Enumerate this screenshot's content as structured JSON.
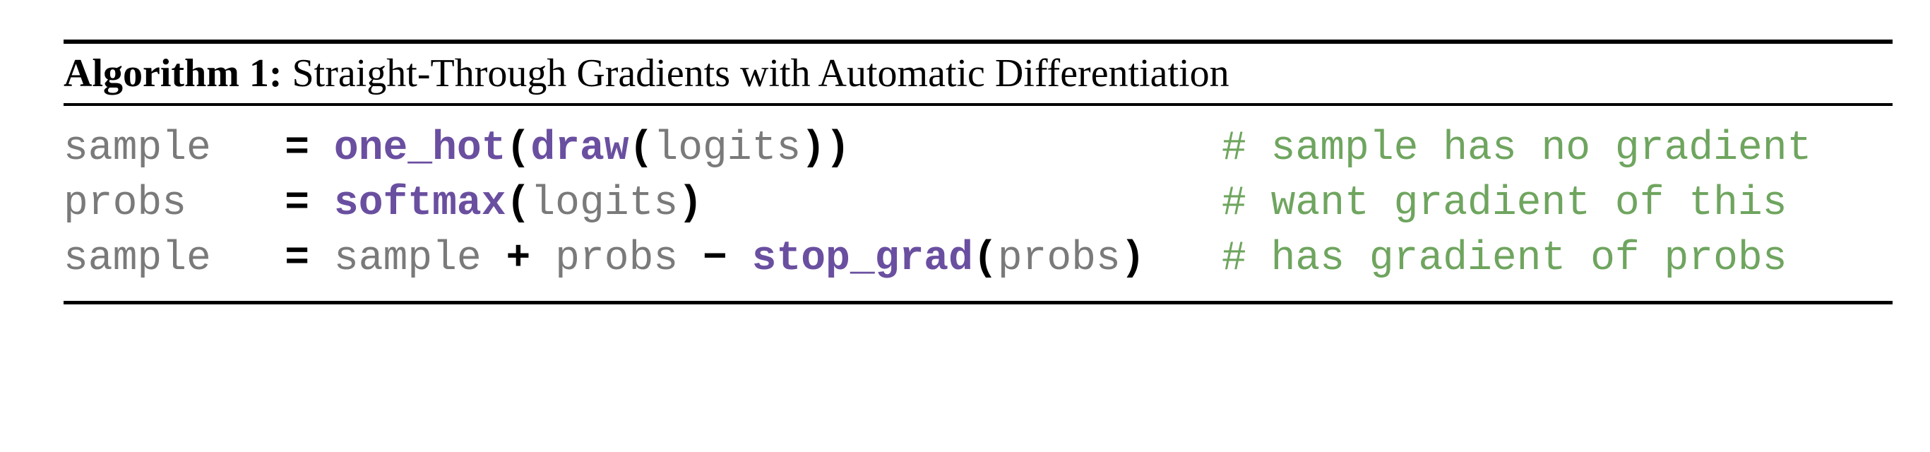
{
  "algorithm": {
    "label": "Algorithm 1:",
    "title": "Straight-Through Gradients with Automatic Differentiation"
  },
  "code": {
    "line1": {
      "lhs": "sample",
      "eq": "=",
      "fn_outer": "one_hot",
      "paren_open_outer": "(",
      "fn_inner": "draw",
      "paren_open_inner": "(",
      "arg": "logits",
      "paren_close": "))",
      "comment": "# sample has no gradient"
    },
    "line2": {
      "lhs": "probs",
      "eq": "=",
      "fn": "softmax",
      "paren_open": "(",
      "arg": "logits",
      "paren_close": ")",
      "comment": "# want gradient of this"
    },
    "line3": {
      "lhs": "sample",
      "eq": "=",
      "term1": "sample",
      "plus": "+",
      "term2": "probs",
      "minus": "−",
      "fn": "stop_grad",
      "paren_open": "(",
      "arg": "probs",
      "paren_close": ")",
      "comment": "# has gradient of probs"
    }
  },
  "colors": {
    "variable": "#7a7a7a",
    "function": "#6a4fa0",
    "operator": "#000000",
    "comment": "#6fa55f"
  }
}
